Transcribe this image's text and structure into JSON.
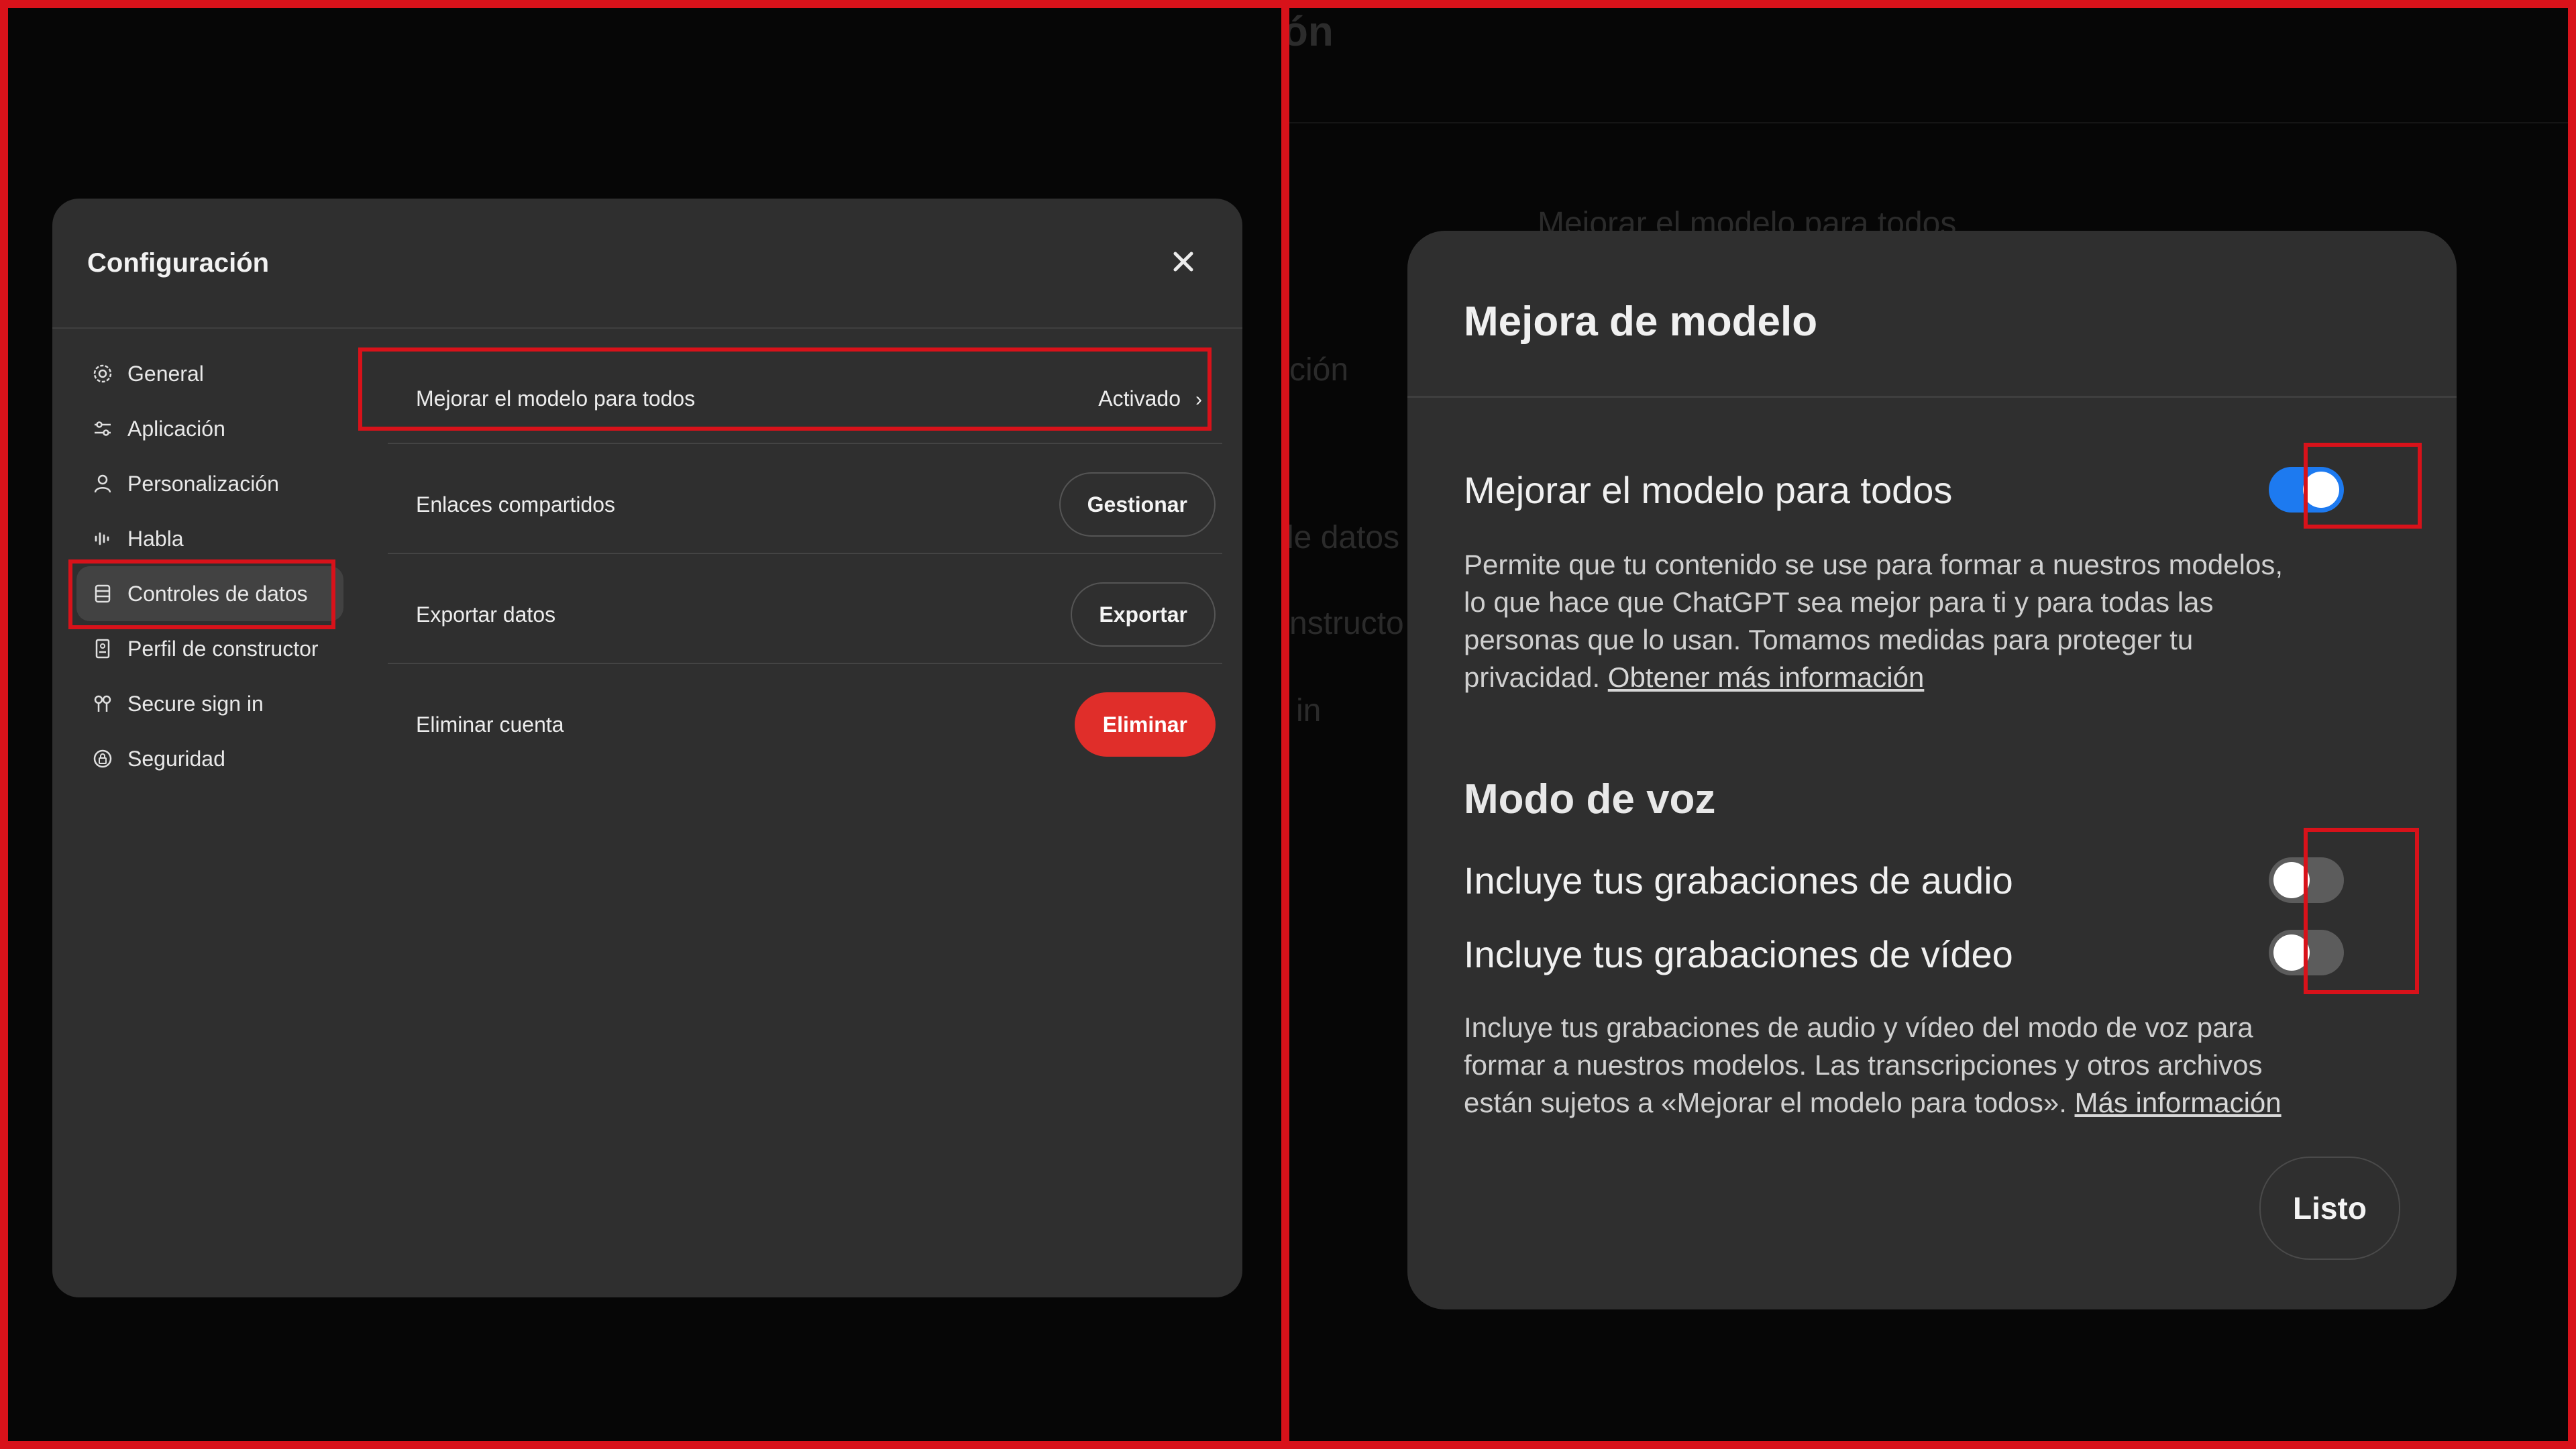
{
  "settings": {
    "title": "Configuración",
    "close_icon": "close-icon",
    "nav": [
      {
        "label": "General",
        "icon": "gear-icon"
      },
      {
        "label": "Aplicación",
        "icon": "sliders-icon"
      },
      {
        "label": "Personalización",
        "icon": "person-icon"
      },
      {
        "label": "Habla",
        "icon": "waveform-icon"
      },
      {
        "label": "Controles de datos",
        "icon": "database-icon",
        "active": true
      },
      {
        "label": "Perfil de constructor",
        "icon": "id-card-icon"
      },
      {
        "label": "Secure sign in",
        "icon": "keys-icon"
      },
      {
        "label": "Seguridad",
        "icon": "shield-lock-icon"
      }
    ],
    "rows": {
      "improve": {
        "label": "Mejorar el modelo para todos",
        "value": "Activado",
        "chevron": "›"
      },
      "shared_links": {
        "label": "Enlaces compartidos",
        "button": "Gestionar"
      },
      "export": {
        "label": "Exportar datos",
        "button": "Exportar"
      },
      "delete": {
        "label": "Eliminar cuenta",
        "button": "Eliminar"
      }
    }
  },
  "background_ghost": {
    "title_fragment": "ón",
    "item_1": "Mejorar el modelo para todos",
    "item_2": "ción",
    "item_3": "le datos",
    "item_4": "nstructo",
    "item_5": "in"
  },
  "dialog": {
    "title": "Mejora de modelo",
    "improve": {
      "heading": "Mejorar el modelo para todos",
      "enabled": true,
      "body": "Permite que tu contenido se use para formar a nuestros modelos, lo que hace que ChatGPT sea mejor para ti y para todas las personas que lo usan. Tomamos medidas para proteger tu privacidad.",
      "link": "Obtener más información"
    },
    "voice": {
      "section": "Modo de voz",
      "audio_label": "Incluye tus grabaciones de audio",
      "audio_enabled": false,
      "video_label": "Incluye tus grabaciones de vídeo",
      "video_enabled": false,
      "body": "Incluye tus grabaciones de audio y vídeo del modo de voz para formar a nuestros modelos. Las transcripciones y otros archivos están sujetos a «Mejorar el modelo para todos».",
      "link": "Más información"
    },
    "done_button": "Listo"
  },
  "colors": {
    "highlight": "#d8121a",
    "toggle_on": "#1d7af0",
    "danger": "#e02e2a",
    "modal_bg": "#2f2f2f"
  }
}
